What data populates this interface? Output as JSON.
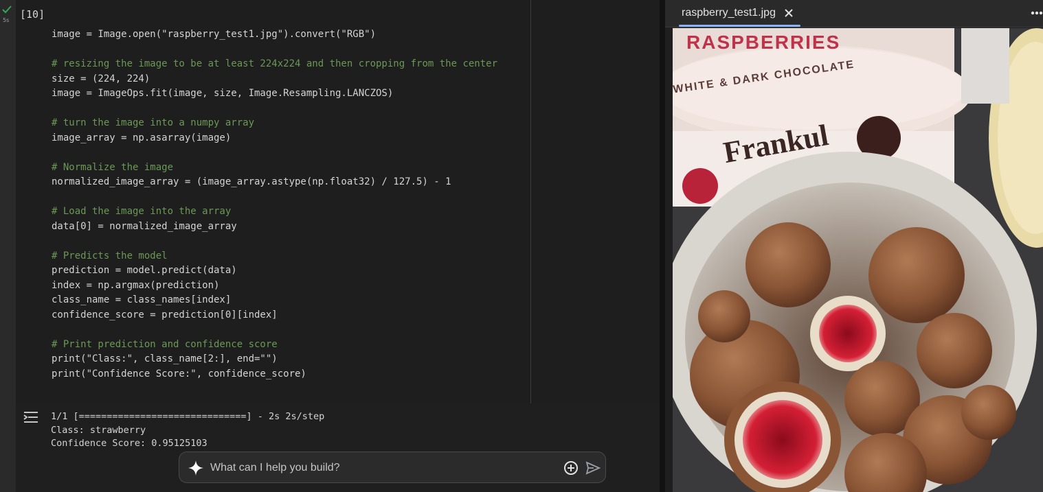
{
  "cell": {
    "execution_count": "[10]",
    "run_status_icon": "check-icon",
    "run_time": "5s"
  },
  "code_lines": [
    "image = Image.open(\"raspberry_test1.jpg\").convert(\"RGB\")",
    "",
    "# resizing the image to be at least 224x224 and then cropping from the center",
    "size = (224, 224)",
    "image = ImageOps.fit(image, size, Image.Resampling.LANCZOS)",
    "",
    "# turn the image into a numpy array",
    "image_array = np.asarray(image)",
    "",
    "# Normalize the image",
    "normalized_image_array = (image_array.astype(np.float32) / 127.5) - 1",
    "",
    "# Load the image into the array",
    "data[0] = normalized_image_array",
    "",
    "# Predicts the model",
    "prediction = model.predict(data)",
    "index = np.argmax(prediction)",
    "class_name = class_names[index]",
    "confidence_score = prediction[0][index]",
    "",
    "# Print prediction and confidence score",
    "print(\"Class:\", class_name[2:], end=\"\")",
    "print(\"Confidence Score:\", confidence_score)"
  ],
  "output": {
    "icon": "output-actions-icon",
    "lines": [
      "1/1 [==============================] - 2s 2s/step",
      "Class: strawberry",
      "Confidence Score: 0.95125103"
    ]
  },
  "ai_bar": {
    "placeholder": "What can I help you build?",
    "sparkle_icon": "sparkle-icon",
    "add_icon": "add-circle-icon",
    "send_icon": "send-icon"
  },
  "viewer": {
    "tab_title": "raspberry_test1.jpg",
    "close_icon": "close-icon",
    "more_icon": "more-horizontal-icon",
    "photo_text": {
      "brand": "RASPBERRIES",
      "variety": "WHITE & DARK CHOCOLATE",
      "logo": "Frankul"
    }
  },
  "colors": {
    "editor_bg": "#1e1e1e",
    "comment": "#6a9955",
    "string": "#ce9178",
    "number": "#b5cea8",
    "bracket": "#ffd700",
    "tab_accent": "#8ab4f8",
    "success": "#34a853"
  }
}
